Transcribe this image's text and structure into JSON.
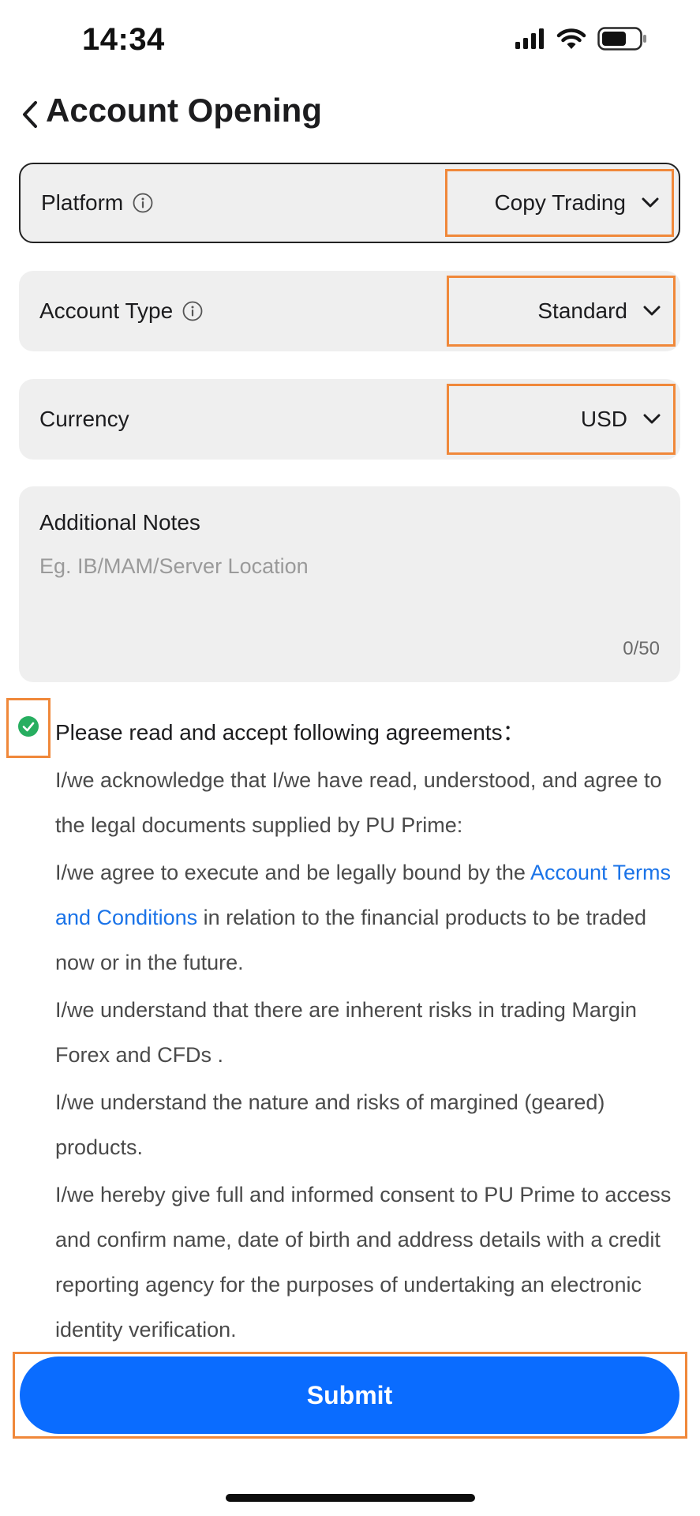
{
  "status_bar": {
    "time": "14:34",
    "icons": [
      "signal-icon",
      "wifi-icon",
      "battery-icon"
    ]
  },
  "header": {
    "back_icon": "chevron-left-icon",
    "title": "Account Opening"
  },
  "form": {
    "platform": {
      "label": "Platform",
      "value": "Copy Trading"
    },
    "account_type": {
      "label": "Account Type",
      "value": "Standard"
    },
    "currency": {
      "label": "Currency",
      "value": "USD"
    },
    "notes": {
      "label": "Additional Notes",
      "placeholder": "Eg. IB/MAM/Server Location",
      "value": "",
      "counter": "0/50"
    }
  },
  "agreements": {
    "checked": true,
    "title": "Please read and accept following agreements：",
    "p1": "I/we acknowledge that I/we have read, understood, and agree to the legal documents supplied by PU Prime:",
    "p2_before": "I/we agree to execute and be legally bound by the ",
    "p2_link": "Account Terms and Conditions",
    "p2_after": " in relation to the financial products to be traded now or in the future.",
    "p3": "I/we understand that there are inherent risks in trading Margin Forex and CFDs .",
    "p4": "I/we understand the nature and risks of margined (geared) products.",
    "p5": "I/we hereby give full and informed consent to PU Prime to access and confirm name, date of birth and address details with a credit reporting agency for the purposes of undertaking an electronic identity verification."
  },
  "submit": {
    "label": "Submit"
  },
  "colors": {
    "accent_blue": "#0a6cff",
    "link_blue": "#1a73e8",
    "highlight_orange": "#f0883a",
    "check_green": "#27ae60",
    "field_bg": "#efefef"
  }
}
